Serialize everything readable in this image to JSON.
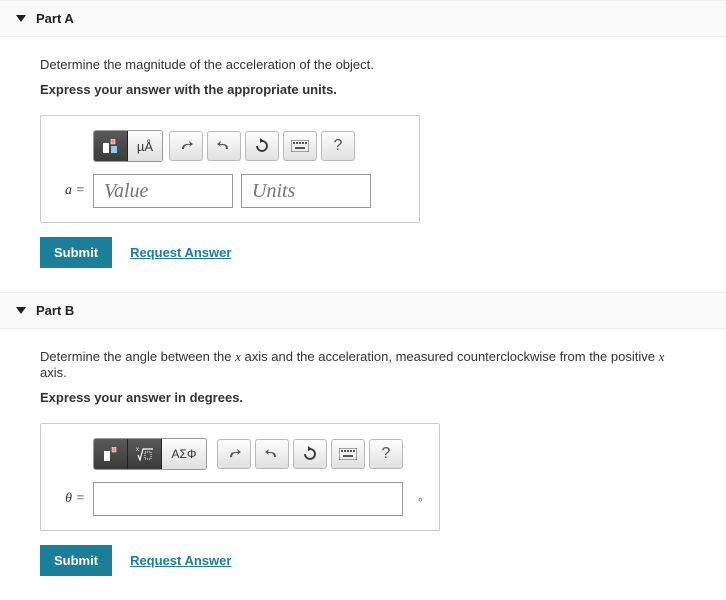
{
  "partA": {
    "title": "Part A",
    "question": "Determine the magnitude of the acceleration of the object.",
    "instruction": "Express your answer with the appropriate units.",
    "varLabel": "a =",
    "valuePlaceholder": "Value",
    "unitsPlaceholder": "Units",
    "submit": "Submit",
    "request": "Request Answer",
    "unitsBtn": "µÅ",
    "helpBtn": "?"
  },
  "partB": {
    "title": "Part B",
    "questionPrefix": "Determine the angle between the ",
    "questionVar1": "x",
    "questionMid": " axis and the acceleration, measured counterclockwise from the positive ",
    "questionVar2": "x",
    "questionSuffix": " axis.",
    "instruction": "Express your answer in degrees.",
    "varLabel": "θ =",
    "degSymbol": "∘",
    "submit": "Submit",
    "request": "Request Answer",
    "greekBtn": "ΑΣΦ",
    "helpBtn": "?"
  }
}
